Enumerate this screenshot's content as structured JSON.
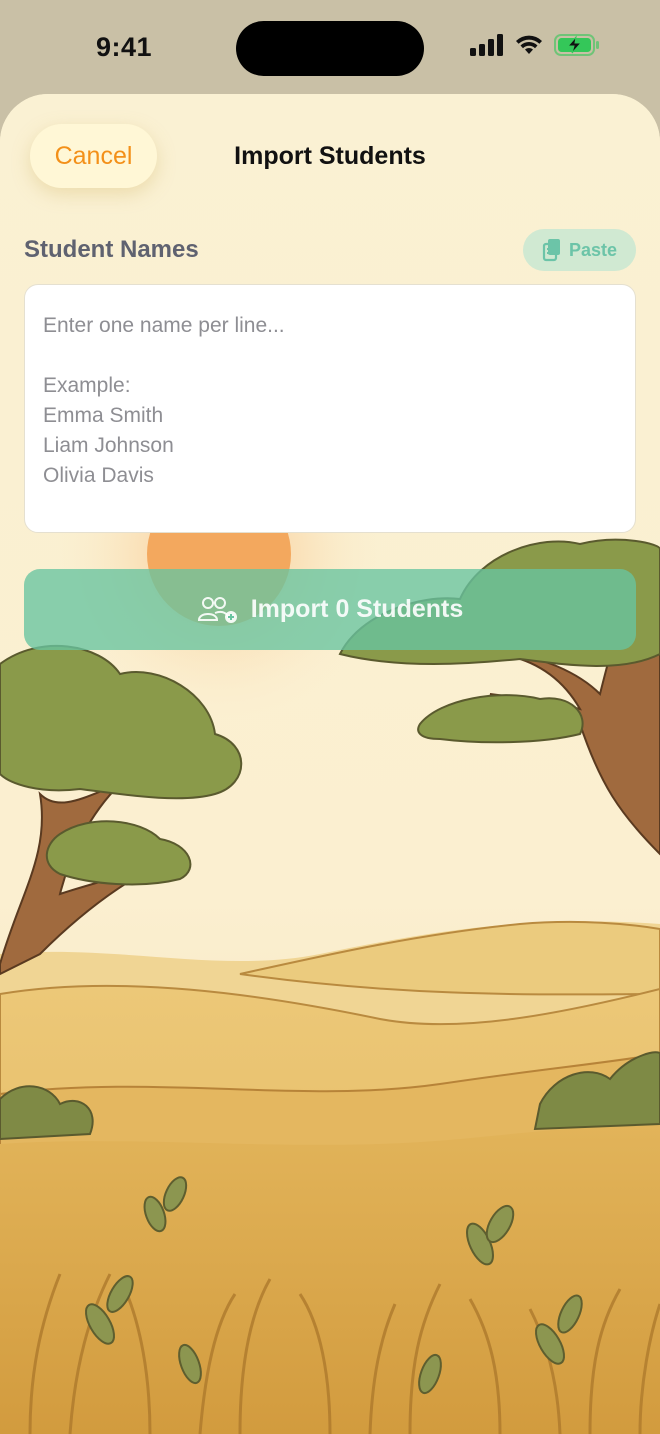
{
  "status_bar": {
    "time": "9:41"
  },
  "header": {
    "cancel_label": "Cancel",
    "title": "Import Students"
  },
  "form": {
    "section_label": "Student Names",
    "paste_label": "Paste",
    "placeholder": "Enter one name per line...\n\nExample:\nEmma Smith\nLiam Johnson\nOlivia Davis",
    "import_label": "Import 0 Students"
  },
  "colors": {
    "accent_orange": "#f39019",
    "accent_green": "#68c4a0",
    "sheet_bg": "#faf1d3"
  },
  "icons": {
    "paste": "clipboard-copy-icon",
    "import": "people-add-icon"
  }
}
